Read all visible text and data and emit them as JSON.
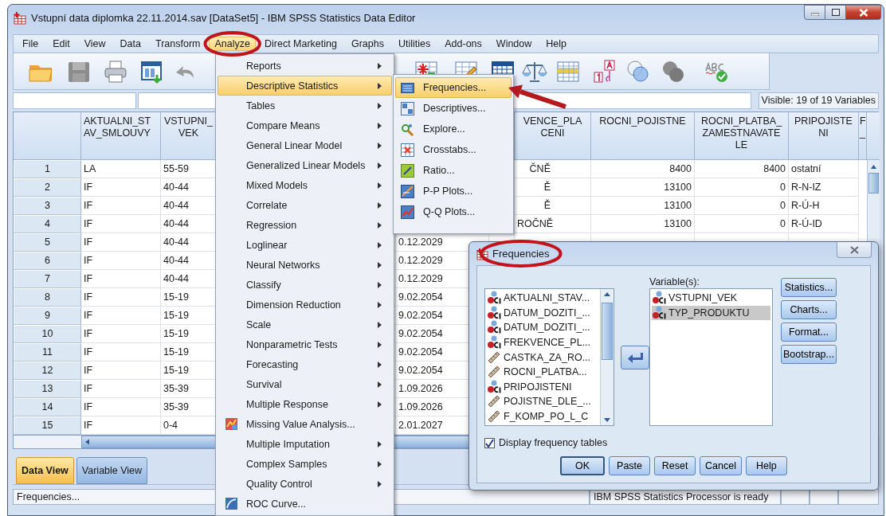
{
  "window": {
    "title": "Vstupní data diplomka 22.11.2014.sav [DataSet5] - IBM SPSS Statistics Data Editor"
  },
  "menubar": [
    {
      "label": "File",
      "selected": false
    },
    {
      "label": "Edit",
      "selected": false
    },
    {
      "label": "View",
      "selected": false
    },
    {
      "label": "Data",
      "selected": false
    },
    {
      "label": "Transform",
      "selected": false
    },
    {
      "label": "Analyze",
      "selected": true
    },
    {
      "label": "Direct Marketing",
      "selected": false
    },
    {
      "label": "Graphs",
      "selected": false
    },
    {
      "label": "Utilities",
      "selected": false
    },
    {
      "label": "Add-ons",
      "selected": false
    },
    {
      "label": "Window",
      "selected": false
    },
    {
      "label": "Help",
      "selected": false
    }
  ],
  "toolbar": {
    "visible_variables": "Visible: 19 of 19 Variables"
  },
  "grid": {
    "columns": [
      {
        "label": "AKTUALNI_ST\nAV_SMLOUVY"
      },
      {
        "label": "VSTUPNI_\nVEK"
      },
      {},
      {
        "label": "VENCE_PLA\nCENI"
      },
      {
        "label": "ROCNI_POJISTNE"
      },
      {
        "label": "ROCNI_PLATBA_\nZAMESTNAVATE\nLE"
      },
      {
        "label": "PRIPOJISTE\nNI"
      },
      {
        "label": "F\n_"
      }
    ],
    "rows": [
      {
        "number": "1",
        "cells": [
          "LA",
          "55-59",
          null,
          "ČNĚ",
          "8400",
          "8400",
          "ostatní",
          null
        ]
      },
      {
        "number": "2",
        "cells": [
          "IF",
          "40-44",
          null,
          "Ě",
          "13100",
          "0",
          "R-N-IZ",
          null
        ]
      },
      {
        "number": "3",
        "cells": [
          "IF",
          "40-44",
          null,
          "Ě",
          "13100",
          "0",
          "R-Ú-H",
          null
        ]
      },
      {
        "number": "4",
        "cells": [
          "IF",
          "40-44",
          null,
          "ROČNĚ",
          "13100",
          "0",
          "R-Ú-ID",
          null
        ]
      },
      {
        "number": "5",
        "cells": [
          "IF",
          "40-44",
          "0.12.2029",
          null,
          null,
          null,
          null,
          null
        ]
      },
      {
        "number": "6",
        "cells": [
          "IF",
          "40-44",
          "0.12.2029",
          null,
          null,
          null,
          null,
          null
        ]
      },
      {
        "number": "7",
        "cells": [
          "IF",
          "40-44",
          "0.12.2029",
          null,
          null,
          null,
          null,
          null
        ]
      },
      {
        "number": "8",
        "cells": [
          "IF",
          "15-19",
          "9.02.2054",
          null,
          null,
          null,
          null,
          null
        ]
      },
      {
        "number": "9",
        "cells": [
          "IF",
          "15-19",
          "9.02.2054",
          null,
          null,
          null,
          null,
          null
        ]
      },
      {
        "number": "10",
        "cells": [
          "IF",
          "15-19",
          "9.02.2054",
          null,
          null,
          null,
          null,
          null
        ]
      },
      {
        "number": "11",
        "cells": [
          "IF",
          "15-19",
          "9.02.2054",
          null,
          null,
          null,
          null,
          null
        ]
      },
      {
        "number": "12",
        "cells": [
          "IF",
          "15-19",
          "9.02.2054",
          null,
          null,
          null,
          null,
          null
        ]
      },
      {
        "number": "13",
        "cells": [
          "IF",
          "35-39",
          "1.09.2026",
          null,
          null,
          null,
          null,
          null
        ]
      },
      {
        "number": "14",
        "cells": [
          "IF",
          "35-39",
          "1.09.2026",
          null,
          null,
          null,
          null,
          null
        ]
      },
      {
        "number": "15",
        "cells": [
          "IF",
          "0-4",
          "2.01.2027",
          null,
          null,
          null,
          null,
          null
        ]
      }
    ]
  },
  "view_tabs": [
    {
      "label": "Data View",
      "selected": true
    },
    {
      "label": "Variable View",
      "selected": false
    }
  ],
  "status_bar": {
    "message": "Frequencies...",
    "processor": "IBM SPSS Statistics Processor is ready"
  },
  "analyze_menu": {
    "items": [
      {
        "label": "Reports",
        "kind": "submenu",
        "selected": false
      },
      {
        "label": "Descriptive Statistics",
        "kind": "submenu",
        "selected": true
      },
      {
        "label": "Tables",
        "kind": "submenu",
        "selected": false
      },
      {
        "label": "Compare Means",
        "kind": "submenu",
        "selected": false
      },
      {
        "label": "General Linear Model",
        "kind": "submenu",
        "selected": false
      },
      {
        "label": "Generalized Linear Models",
        "kind": "submenu",
        "selected": false
      },
      {
        "label": "Mixed Models",
        "kind": "submenu",
        "selected": false
      },
      {
        "label": "Correlate",
        "kind": "submenu",
        "selected": false
      },
      {
        "label": "Regression",
        "kind": "submenu",
        "selected": false
      },
      {
        "label": "Loglinear",
        "kind": "submenu",
        "selected": false
      },
      {
        "label": "Neural Networks",
        "kind": "submenu",
        "selected": false
      },
      {
        "label": "Classify",
        "kind": "submenu",
        "selected": false
      },
      {
        "label": "Dimension Reduction",
        "kind": "submenu",
        "selected": false
      },
      {
        "label": "Scale",
        "kind": "submenu",
        "selected": false
      },
      {
        "label": "Nonparametric Tests",
        "kind": "submenu",
        "selected": false
      },
      {
        "label": "Forecasting",
        "kind": "submenu",
        "selected": false
      },
      {
        "label": "Survival",
        "kind": "submenu",
        "selected": false
      },
      {
        "label": "Multiple Response",
        "kind": "submenu",
        "selected": false
      },
      {
        "label": "Missing Value Analysis...",
        "kind": "command",
        "selected": false
      },
      {
        "label": "Multiple Imputation",
        "kind": "submenu",
        "selected": false
      },
      {
        "label": "Complex Samples",
        "kind": "submenu",
        "selected": false
      },
      {
        "label": "Quality Control",
        "kind": "submenu",
        "selected": false
      },
      {
        "label": "ROC Curve...",
        "kind": "command",
        "selected": false
      }
    ]
  },
  "descriptive_statistics_submenu": {
    "items": [
      {
        "label": "Frequencies...",
        "selected": true
      },
      {
        "label": "Descriptives...",
        "selected": false
      },
      {
        "label": "Explore...",
        "selected": false
      },
      {
        "label": "Crosstabs...",
        "selected": false
      },
      {
        "label": "Ratio...",
        "selected": false
      },
      {
        "label": "P-P Plots...",
        "selected": false
      },
      {
        "label": "Q-Q Plots...",
        "selected": false
      }
    ]
  },
  "frequencies_dialog": {
    "title": "Frequencies",
    "source_variables": [
      {
        "name": "AKTUALNI_STAV...",
        "kind": "nominal"
      },
      {
        "name": "DATUM_DOZITI_...",
        "kind": "nominal"
      },
      {
        "name": "DATUM_DOZITI_...",
        "kind": "nominal"
      },
      {
        "name": "FREKVENCE_PL...",
        "kind": "nominal"
      },
      {
        "name": "CASTKA_ZA_RO...",
        "kind": "scale"
      },
      {
        "name": "ROCNI_PLATBA...",
        "kind": "scale"
      },
      {
        "name": "PRIPOJISTENI",
        "kind": "nominal"
      },
      {
        "name": "POJISTNE_DLE_...",
        "kind": "scale"
      },
      {
        "name": "F_KOMP_PO_L_C",
        "kind": "scale"
      }
    ],
    "target_label": "Variable(s):",
    "target_variables": [
      {
        "name": "VSTUPNI_VEK",
        "kind": "nominal",
        "selected": false
      },
      {
        "name": "TYP_PRODUKTU",
        "kind": "nominal",
        "selected": true
      }
    ],
    "side_buttons": [
      "Statistics...",
      "Charts...",
      "Format...",
      "Bootstrap..."
    ],
    "display_frequency_tables": {
      "label": "Display frequency tables",
      "checked": true
    },
    "buttons": [
      {
        "label": "OK",
        "default": true
      },
      {
        "label": "Paste",
        "default": false
      },
      {
        "label": "Reset",
        "default": false
      },
      {
        "label": "Cancel",
        "default": false
      },
      {
        "label": "Help",
        "default": false
      }
    ]
  }
}
